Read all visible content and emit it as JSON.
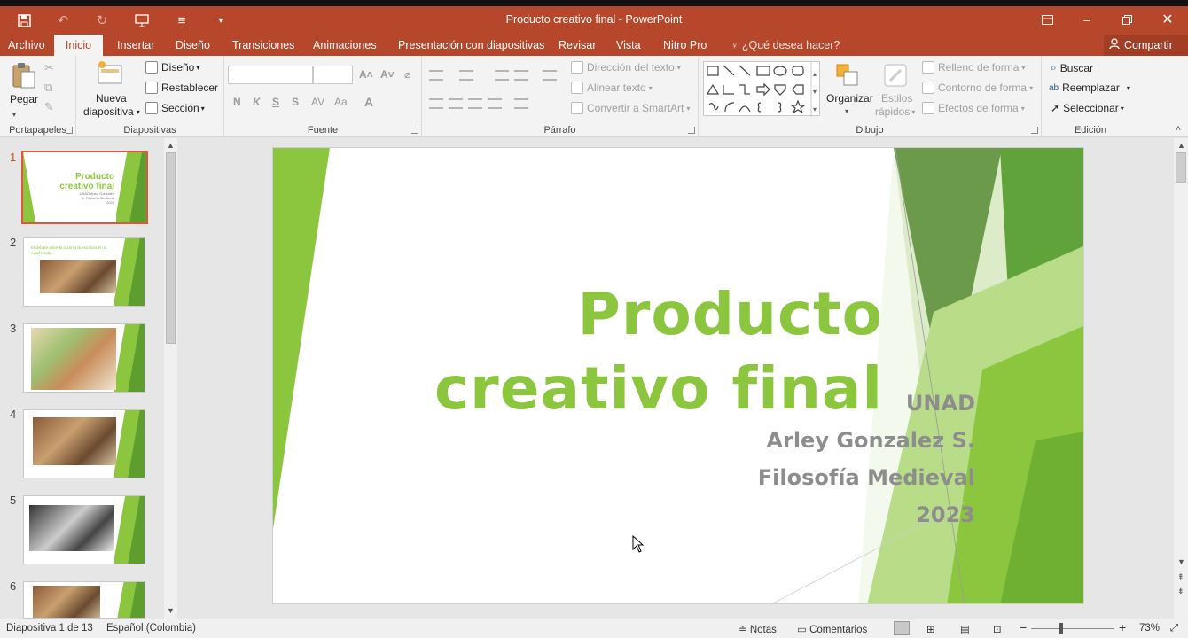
{
  "window": {
    "title": "Producto creativo final - PowerPoint"
  },
  "qat": {
    "save_icon": "save-icon",
    "undo_icon": "undo-icon",
    "redo_icon": "redo-icon",
    "present_icon": "present-from-start-icon",
    "touch_icon": "touch-mode-icon",
    "customize_icon": "customize-qat-icon"
  },
  "tabs": [
    "Archivo",
    "Inicio",
    "Insertar",
    "Diseño",
    "Transiciones",
    "Animaciones",
    "Presentación con diapositivas",
    "Revisar",
    "Vista",
    "Nitro Pro"
  ],
  "active_tab": "Inicio",
  "tell_me": "¿Qué desea hacer?",
  "share_label": "Compartir",
  "ribbon": {
    "portapapeles": {
      "label": "Portapapeles",
      "paste": "Pegar"
    },
    "diapositivas": {
      "label": "Diapositivas",
      "new_slide_1": "Nueva",
      "new_slide_2": "diapositiva",
      "layout": "Diseño",
      "reset": "Restablecer",
      "section": "Sección"
    },
    "fuente": {
      "label": "Fuente",
      "bold": "N",
      "italic": "K",
      "underline": "S",
      "strike": "S",
      "font_color": "A"
    },
    "parrafo": {
      "label": "Párrafo",
      "text_direction": "Dirección del texto",
      "align_text": "Alinear texto",
      "smartart": "Convertir a SmartArt"
    },
    "dibujo": {
      "label": "Dibujo",
      "arrange": "Organizar",
      "styles_1": "Estilos",
      "styles_2": "rápidos",
      "fill": "Relleno de forma",
      "outline": "Contorno de forma",
      "effects": "Efectos de forma"
    },
    "edicion": {
      "label": "Edición",
      "find": "Buscar",
      "replace": "Reemplazar",
      "select": "Seleccionar"
    }
  },
  "thumbnails": [
    {
      "num": "1",
      "title": "Producto creativo final",
      "lines": "UNAD Arley Gonzalez S. Filosofía Medieval 2023"
    },
    {
      "num": "2",
      "heading": "El debate entre la razón y la escritura en la edad media"
    },
    {
      "num": "3"
    },
    {
      "num": "4"
    },
    {
      "num": "5"
    },
    {
      "num": "6"
    }
  ],
  "slide": {
    "title_line1": "Producto",
    "title_line2": "creativo final",
    "org": "UNAD",
    "author": "Arley Gonzalez S.",
    "course": "Filosofía Medieval",
    "year": "2023"
  },
  "colors": {
    "accent": "#b7472a",
    "green": "#8cc63f",
    "dark_green": "#5e9e2e"
  },
  "status": {
    "slide_info": "Diapositiva 1 de 13",
    "language": "Español (Colombia)",
    "notes": "Notas",
    "comments": "Comentarios",
    "zoom": "73%",
    "zoom_minus": "−",
    "zoom_plus": "+"
  }
}
